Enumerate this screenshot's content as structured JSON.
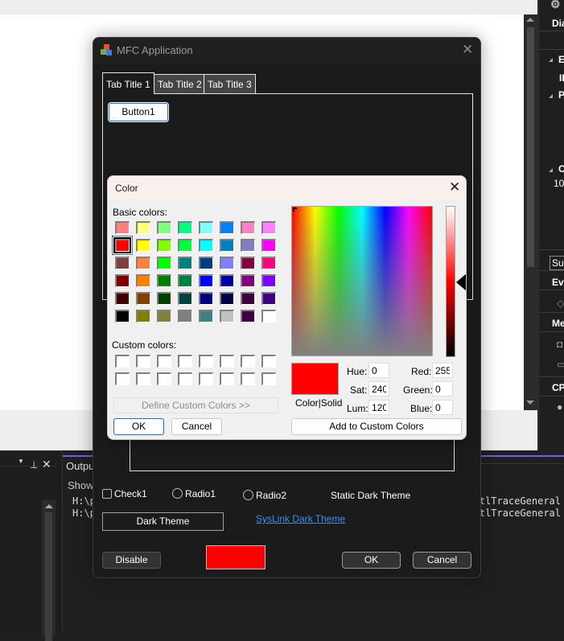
{
  "ide": {
    "right_panel": {
      "items": [
        "Dia",
        "Ev",
        "II",
        "Pr",
        "C",
        "10",
        "Sur",
        "Eve",
        "Me",
        "CPI"
      ]
    },
    "output": {
      "title": "Outpu",
      "show_label": "Show",
      "lines": [
        "H:\\p",
        "H:\\p"
      ],
      "lines_right": [
        "atlTraceGeneral",
        "atlTraceGeneral"
      ],
      "accent_color": "#7160e8"
    }
  },
  "mfc_dialog": {
    "title": "MFC Application",
    "close_icon": "close-icon",
    "tabs": [
      {
        "label": "Tab Title 1",
        "active": true
      },
      {
        "label": "Tab Title 2",
        "active": false
      },
      {
        "label": "Tab Title 3",
        "active": false
      }
    ],
    "button1_label": "Button1",
    "check1_label": "Check1",
    "radio1_label": "Radio1",
    "radio2_label": "Radio2",
    "static_label": "Static Dark Theme",
    "dark_theme_button": "Dark Theme",
    "syslink_label": "SysLink Dark Theme",
    "disable_button": "Disable",
    "ok_button": "OK",
    "cancel_button": "Cancel",
    "selected_color": "#ff0000"
  },
  "color_dialog": {
    "title": "Color",
    "basic_colors_label": "Basic colors:",
    "basic_colors": [
      [
        "#ff8080",
        "#ffff80",
        "#80ff80",
        "#00ff80",
        "#80ffff",
        "#0080ff",
        "#ff80c0",
        "#ff80ff"
      ],
      [
        "#ff0000",
        "#ffff00",
        "#80ff00",
        "#00ff40",
        "#00ffff",
        "#0080c0",
        "#8080c0",
        "#ff00ff"
      ],
      [
        "#804040",
        "#ff8040",
        "#00ff00",
        "#008080",
        "#004080",
        "#8080ff",
        "#800040",
        "#ff0080"
      ],
      [
        "#800000",
        "#ff8000",
        "#008000",
        "#008040",
        "#0000ff",
        "#0000a0",
        "#800080",
        "#8000ff"
      ],
      [
        "#400000",
        "#804000",
        "#004000",
        "#004040",
        "#000080",
        "#000040",
        "#400040",
        "#400080"
      ],
      [
        "#000000",
        "#808000",
        "#808040",
        "#808080",
        "#408080",
        "#c0c0c0",
        "#400040",
        "#ffffff"
      ]
    ],
    "selected_basic": {
      "row": 1,
      "col": 0
    },
    "custom_colors_label": "Custom colors:",
    "custom_colors_count": 16,
    "define_custom_button": "Define Custom Colors >>",
    "ok_button": "OK",
    "cancel_button": "Cancel",
    "color_solid_label": "Color|Solid",
    "hue_label": "Hue:",
    "sat_label": "Sat:",
    "lum_label": "Lum:",
    "red_label": "Red:",
    "green_label": "Green:",
    "blue_label": "Blue:",
    "hue": "0",
    "sat": "240",
    "lum": "120",
    "red": "255",
    "green": "0",
    "blue": "0",
    "add_custom_button": "Add to Custom Colors",
    "current_color": "#ff0000"
  }
}
